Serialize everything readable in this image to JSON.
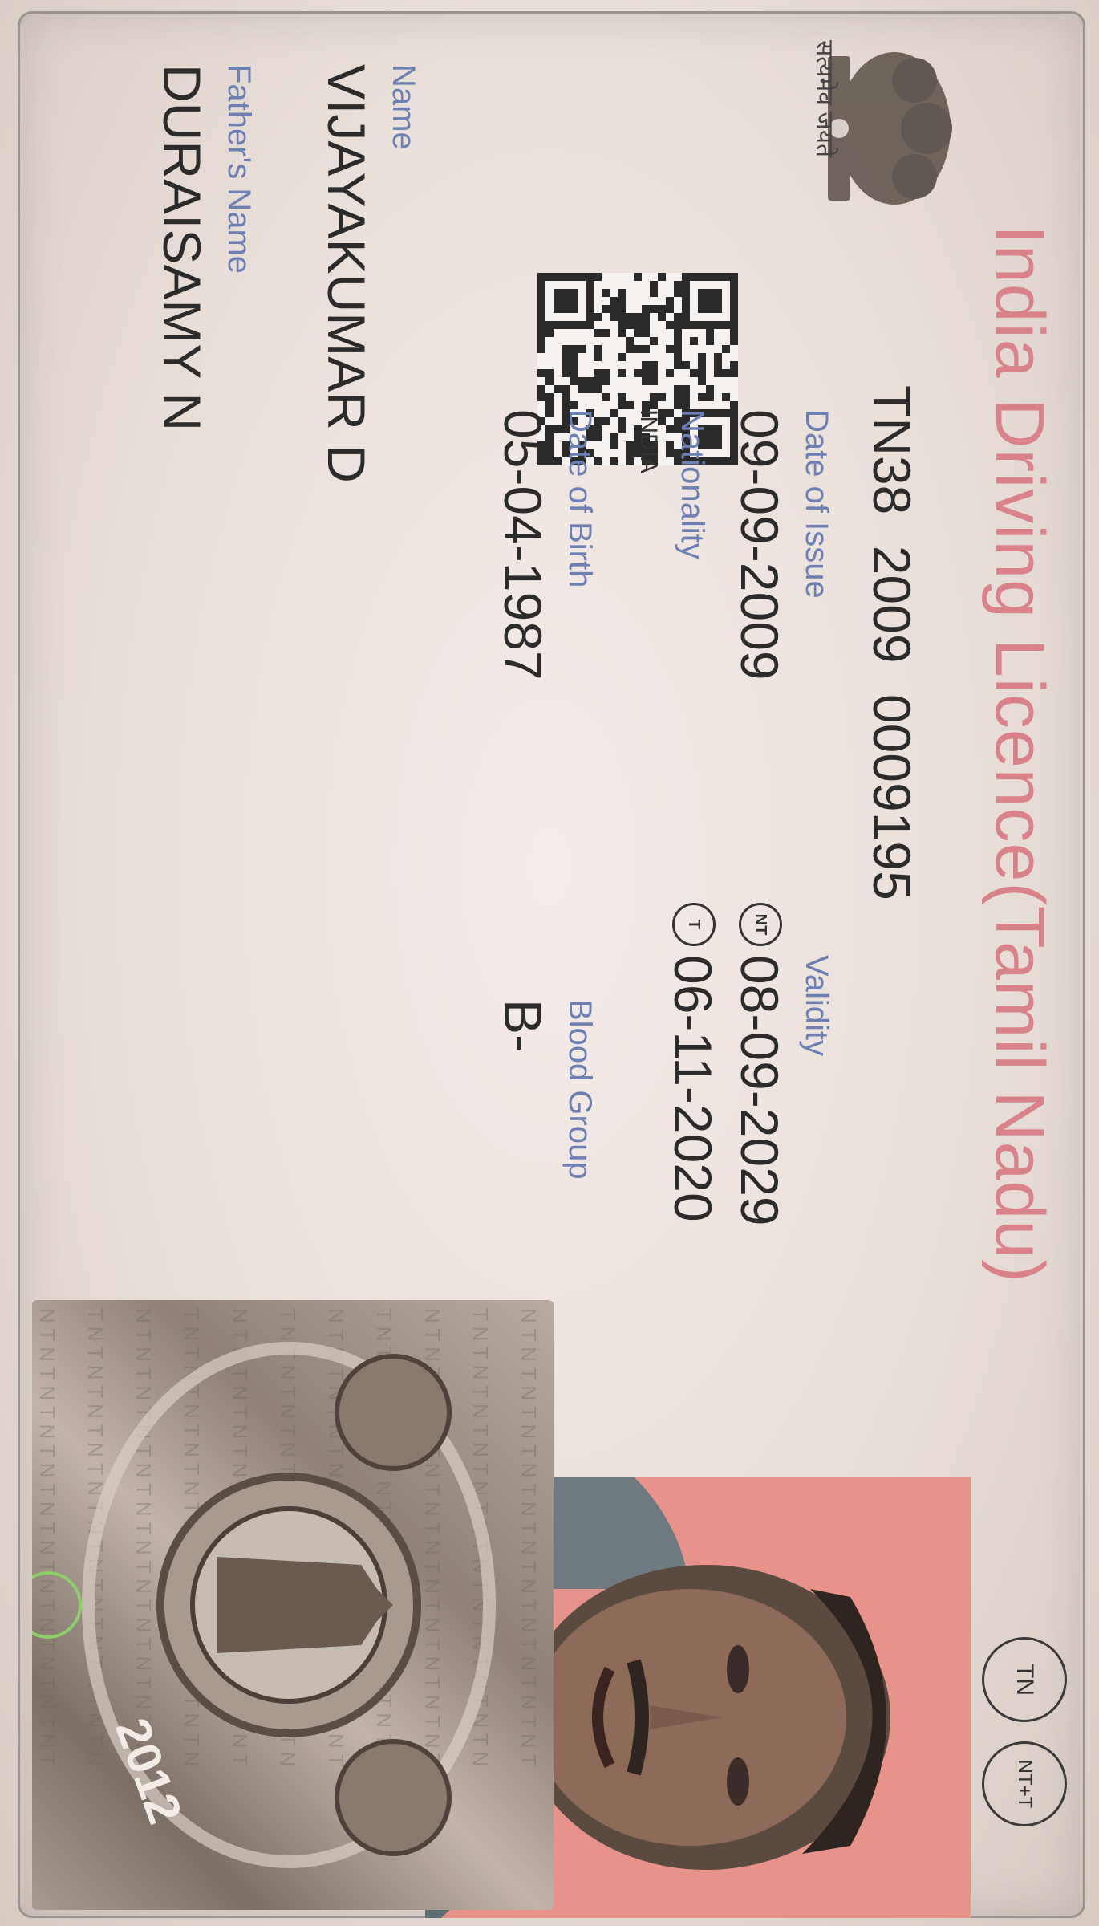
{
  "card": {
    "title": "India Driving Licence(Tamil Nadu)",
    "emblem_text": "सत्यमेव जयते",
    "licence_number": "TN38 2009 0009195",
    "date_of_issue_label": "Date of Issue",
    "date_of_issue": "09-09-2009",
    "validity_label": "Validity",
    "validity_nt_badge": "NT",
    "validity_nt": "08-09-2029",
    "validity_t_badge": "T",
    "validity_t": "06-11-2020",
    "nationality_label": "Nationality",
    "nationality": "INDIA",
    "dob_label": "Date of Birth",
    "dob": "05-04-1987",
    "blood_group_label": "Blood Group",
    "blood_group": "B-",
    "name_label": "Name",
    "name": "VIJAYAKUMAR  D",
    "father_label": "Father's Name",
    "father_name": "DURAISAMY  N",
    "badge_tn": "TN",
    "badge_ntt": "NT+T",
    "hologram_year": "2012"
  },
  "colors": {
    "title": "#d9828a",
    "label": "#6d7fb3",
    "text": "#2b2b2b",
    "portrait_bg": "#e7938b"
  }
}
